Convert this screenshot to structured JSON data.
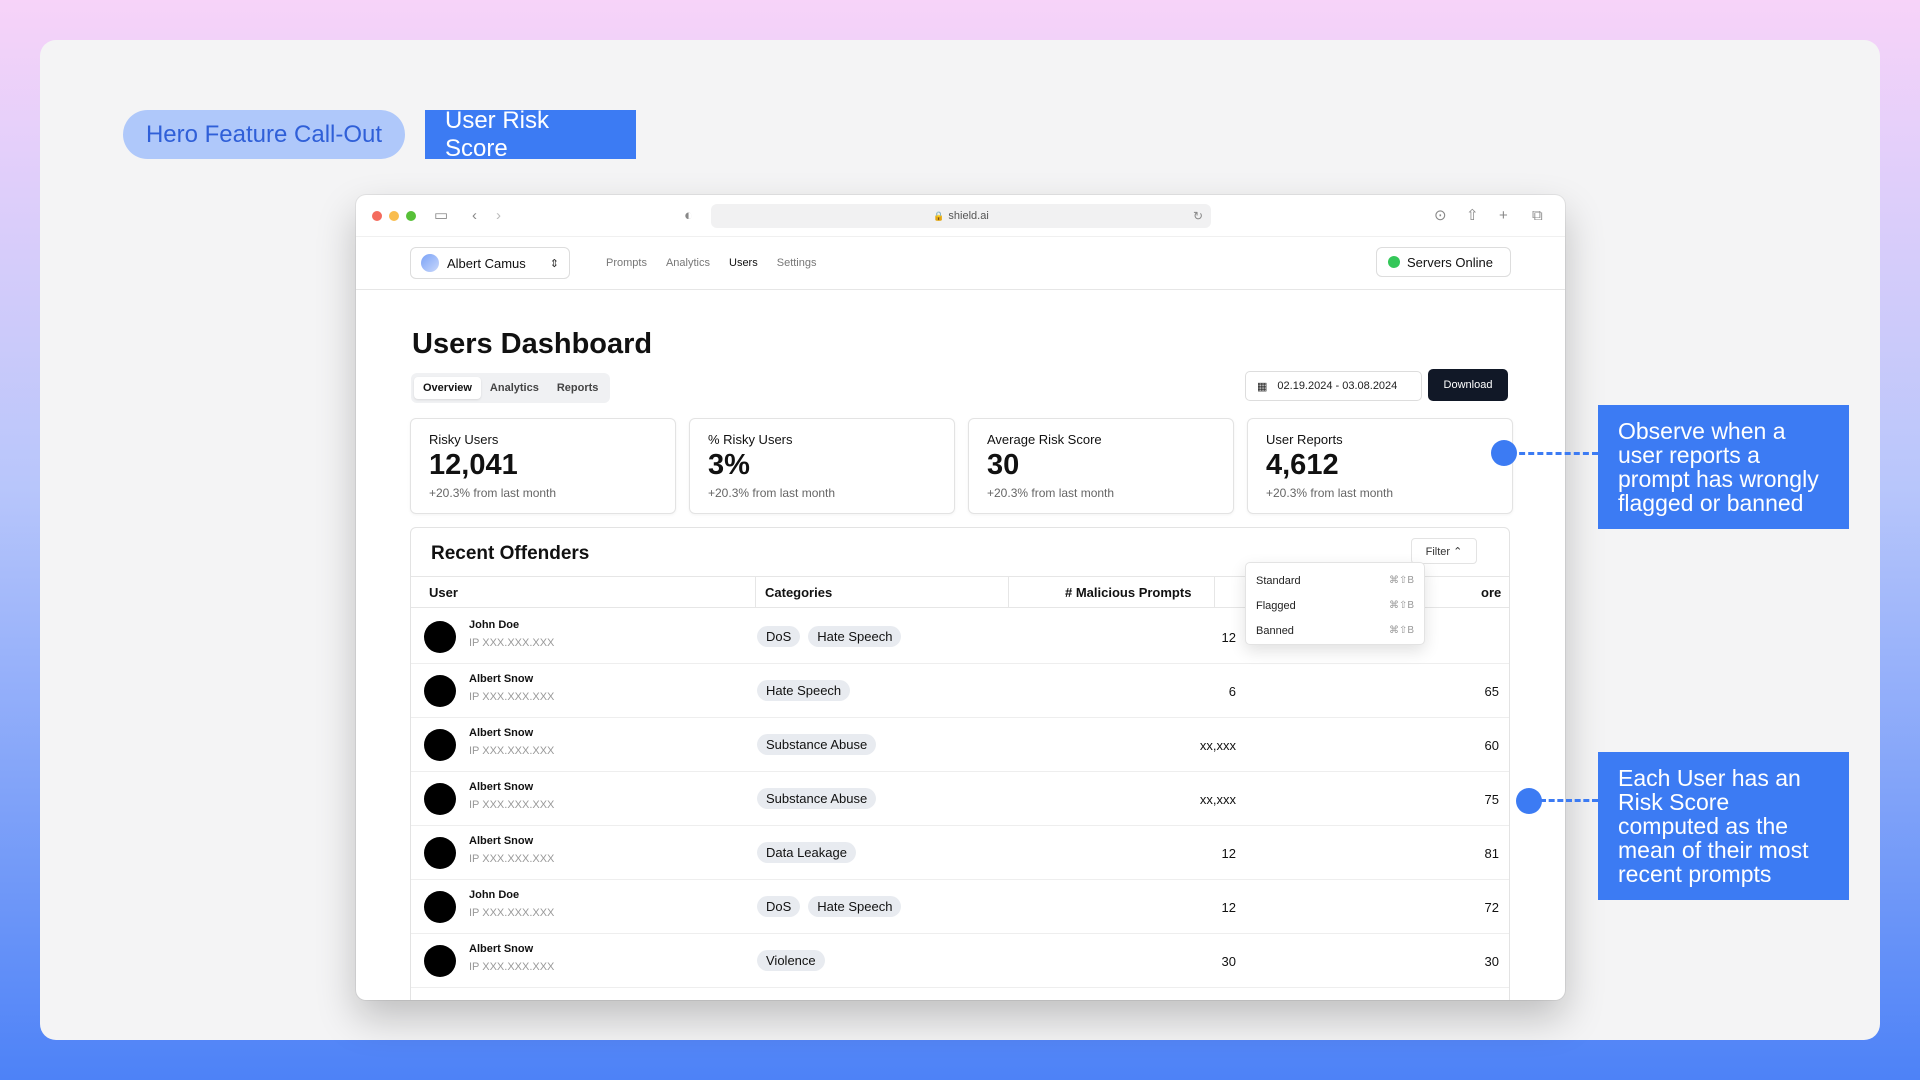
{
  "badges": {
    "hero": "Hero Feature Call-Out",
    "score": "User Risk Score"
  },
  "browser": {
    "url": "shield.ai"
  },
  "app": {
    "account": "Albert Camus",
    "nav": [
      "Prompts",
      "Analytics",
      "Users",
      "Settings"
    ],
    "active_nav": "Users",
    "status": "Servers Online"
  },
  "dashboard": {
    "title": "Users Dashboard",
    "tabs": [
      "Overview",
      "Analytics",
      "Reports"
    ],
    "active_tab": "Overview",
    "date_range": "02.19.2024 - 03.08.2024",
    "download": "Download"
  },
  "stats": [
    {
      "label": "Risky Users",
      "value": "12,041",
      "change": "+20.3% from last month"
    },
    {
      "label": "% Risky Users",
      "value": "3%",
      "change": "+20.3% from last month"
    },
    {
      "label": "Average Risk Score",
      "value": "30",
      "change": "+20.3% from last month"
    },
    {
      "label": "User Reports",
      "value": "4,612",
      "change": "+20.3% from last month"
    }
  ],
  "offenders": {
    "title": "Recent Offenders",
    "filter": "Filter ⌃",
    "columns": [
      "User",
      "Categories",
      "# Malicious Prompts",
      "ore"
    ],
    "rows": [
      {
        "name": "John Doe",
        "ip": "IP XXX.XXX.XXX",
        "tags": [
          "DoS",
          "Hate Speech"
        ],
        "malicious": "12",
        "score": ""
      },
      {
        "name": "Albert Snow",
        "ip": "IP XXX.XXX.XXX",
        "tags": [
          "Hate Speech"
        ],
        "malicious": "6",
        "score": "65"
      },
      {
        "name": "Albert Snow",
        "ip": "IP XXX.XXX.XXX",
        "tags": [
          "Substance Abuse"
        ],
        "malicious": "xx,xxx",
        "score": "60"
      },
      {
        "name": "Albert Snow",
        "ip": "IP XXX.XXX.XXX",
        "tags": [
          "Substance Abuse"
        ],
        "malicious": "xx,xxx",
        "score": "75"
      },
      {
        "name": "Albert Snow",
        "ip": "IP XXX.XXX.XXX",
        "tags": [
          "Data Leakage"
        ],
        "malicious": "12",
        "score": "81"
      },
      {
        "name": "John Doe",
        "ip": "IP XXX.XXX.XXX",
        "tags": [
          "DoS",
          "Hate Speech"
        ],
        "malicious": "12",
        "score": "72"
      },
      {
        "name": "Albert Snow",
        "ip": "IP XXX.XXX.XXX",
        "tags": [
          "Violence"
        ],
        "malicious": "30",
        "score": "30"
      }
    ]
  },
  "filter_menu": [
    {
      "label": "Standard",
      "shortcut": "⌘⇧B"
    },
    {
      "label": "Flagged",
      "shortcut": "⌘⇧B"
    },
    {
      "label": "Banned",
      "shortcut": "⌘⇧B"
    }
  ],
  "callouts": {
    "reports": "Observe when a user reports a prompt has wrongly flagged or banned",
    "risk": "Each User has an Risk Score computed as the mean of their most recent prompts"
  },
  "colors": {
    "accent": "#3c7bf3",
    "traffic": [
      "#f46b5d",
      "#f9bd4e",
      "#57c038"
    ]
  }
}
